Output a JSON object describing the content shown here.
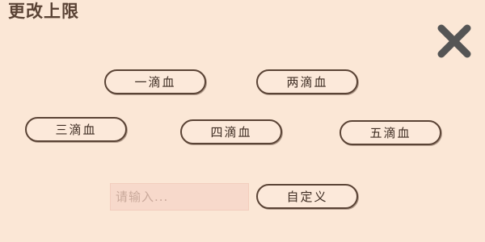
{
  "dialog": {
    "title": "更改上限",
    "close_icon": "close-icon"
  },
  "options": {
    "one_drop": "一滴血",
    "two_drops": "两滴血",
    "three_drops": "三滴血",
    "four_drops": "四滴血",
    "five_drops": "五滴血"
  },
  "custom": {
    "placeholder": "请输入...",
    "value": "",
    "button_label": "自定义"
  },
  "colors": {
    "background": "#fbe7d6",
    "outline": "#5a4335",
    "text": "#3f2e24",
    "input_bg": "#f7d9cb",
    "placeholder": "#c9a99b",
    "close": "#555555"
  }
}
